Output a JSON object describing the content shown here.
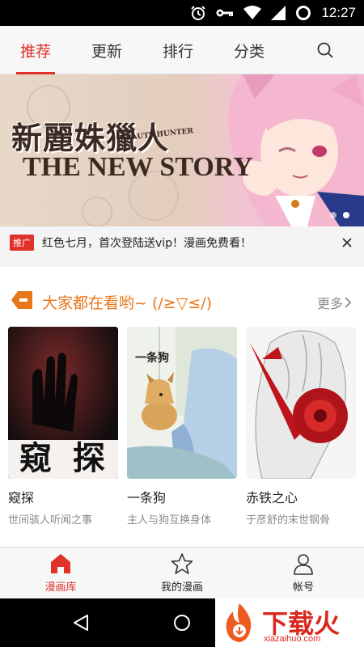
{
  "status_bar": {
    "time": "12:27",
    "icons": [
      "alarm-icon",
      "key-icon",
      "wifi-icon",
      "signal-icon",
      "battery-icon"
    ]
  },
  "top_tabs": [
    {
      "label": "推荐",
      "active": true
    },
    {
      "label": "更新",
      "active": false
    },
    {
      "label": "排行",
      "active": false
    },
    {
      "label": "分类",
      "active": false
    }
  ],
  "banner": {
    "title_cn": "新麗姝獵人",
    "title_en_small": "BEAUTY HUNTER",
    "subtitle": "THE NEW STORY",
    "dots": 2,
    "active_dot": 1
  },
  "promo": {
    "badge": "推广",
    "text": "红色七月，首次登陆送vip！漫画免费看！"
  },
  "section": {
    "title": "大家都在看哟~ (/≥▽≤/)",
    "more": "更多",
    "cards": [
      {
        "title": "窥探",
        "subtitle": "世间骇人听闻之事",
        "cover_text": "窥 探"
      },
      {
        "title": "一条狗",
        "subtitle": "主人与狗互换身体",
        "cover_text": "一条狗"
      },
      {
        "title": "赤铁之心",
        "subtitle": "于彦舒的末世钢骨",
        "cover_text": ""
      }
    ]
  },
  "bottom_nav": [
    {
      "label": "漫画库",
      "active": true,
      "icon": "home-icon"
    },
    {
      "label": "我的漫画",
      "active": false,
      "icon": "star-icon"
    },
    {
      "label": "帐号",
      "active": false,
      "icon": "person-icon"
    }
  ],
  "watermark": {
    "text": "下载火",
    "url": "xiazaihuo.com"
  },
  "colors": {
    "accent": "#e0312b",
    "section_title": "#e8771c",
    "muted": "#8a8a8a"
  }
}
